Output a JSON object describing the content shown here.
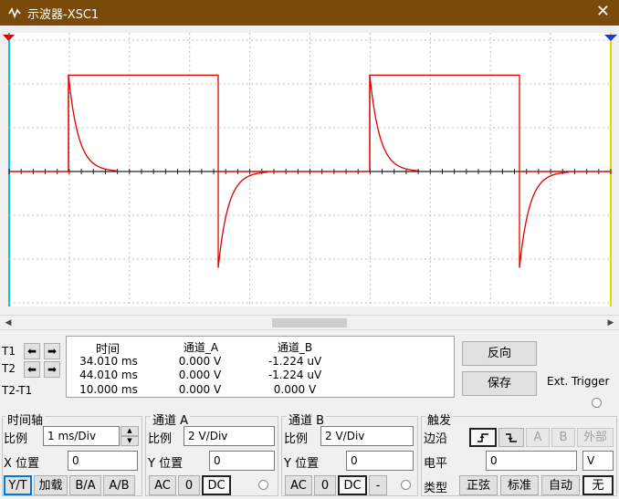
{
  "window": {
    "title": "示波器-XSC1"
  },
  "scope_plot": {
    "chart_data": {
      "type": "line",
      "series": [
        {
          "color": "#e00000"
        },
        {
          "color": "#e00000"
        }
      ]
    }
  },
  "cursors": {
    "t1": "T1",
    "t2": "T2",
    "t2t1": "T2-T1"
  },
  "readout": {
    "headers": {
      "time": "时间",
      "chA": "通道_A",
      "chB": "通道_B"
    },
    "rows": [
      {
        "time": "34.010 ms",
        "a": "0.000 V",
        "b": "-1.224 uV"
      },
      {
        "time": "44.010 ms",
        "a": "0.000 V",
        "b": "-1.224 uV"
      },
      {
        "time": "10.000 ms",
        "a": "0.000 V",
        "b": "0.000 V"
      }
    ]
  },
  "buttons": {
    "reverse": "反向",
    "save": "保存",
    "ext_trigger": "Ext. Trigger"
  },
  "timebase": {
    "title": "时间轴",
    "scale_label": "比例",
    "scale_value": "1 ms/Div",
    "xpos_label": "X 位置",
    "xpos_value": "0",
    "modes": [
      "Y/T",
      "加载",
      "B/A",
      "A/B"
    ]
  },
  "channel_a": {
    "title": "通道 A",
    "scale_label": "比例",
    "scale_value": "2  V/Div",
    "ypos_label": "Y 位置",
    "ypos_value": "0",
    "coupling": [
      "AC",
      "0",
      "DC"
    ]
  },
  "channel_b": {
    "title": "通道 B",
    "scale_label": "比例",
    "scale_value": "2  V/Div",
    "ypos_label": "Y 位置",
    "ypos_value": "0",
    "coupling": [
      "AC",
      "0",
      "DC",
      "-"
    ]
  },
  "trigger": {
    "title": "触发",
    "edge_label": "边沿",
    "edge_buttons": [
      "A",
      "B",
      "外部"
    ],
    "level_label": "电平",
    "level_value": "0",
    "level_unit": "V",
    "type_label": "类型",
    "types": [
      "正弦",
      "标准",
      "自动",
      "无"
    ]
  }
}
